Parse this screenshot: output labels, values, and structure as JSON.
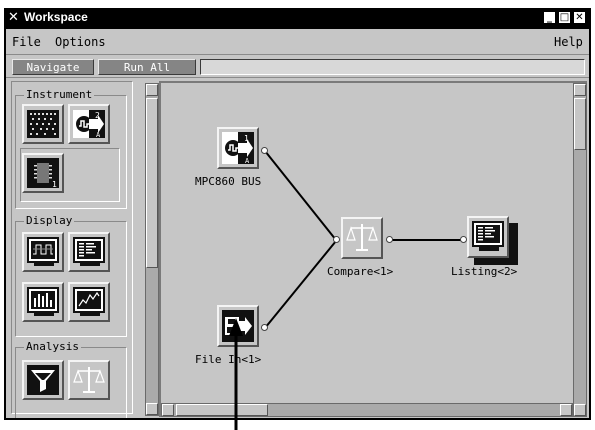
{
  "window": {
    "title": "Workspace",
    "title_icon": "x-logo-icon",
    "controls": [
      "minimize",
      "maximize",
      "close"
    ]
  },
  "menubar": {
    "file": "File",
    "options": "Options",
    "help": "Help"
  },
  "toolbar": {
    "navigate": "Navigate",
    "run_all": "Run All",
    "status": ""
  },
  "palette": {
    "groups": [
      {
        "label": "Instrument",
        "items": [
          "logic-analyzer-icon",
          "mpc860-bus-icon",
          "chip-icon"
        ]
      },
      {
        "label": "Display",
        "items": [
          "waveform-display-icon",
          "listing-display-icon",
          "histogram-display-icon",
          "chart-display-icon"
        ]
      },
      {
        "label": "Analysis",
        "items": [
          "filter-icon",
          "compare-icon"
        ]
      }
    ]
  },
  "canvas": {
    "nodes": {
      "mpc860": {
        "label": "MPC860 BUS",
        "icon": "mpc860-bus-icon"
      },
      "filein": {
        "label": "File In<1>",
        "icon": "file-in-icon"
      },
      "compare": {
        "label": "Compare<1>",
        "icon": "compare-icon"
      },
      "listing": {
        "label": "Listing<2>",
        "icon": "listing-icon"
      }
    }
  }
}
